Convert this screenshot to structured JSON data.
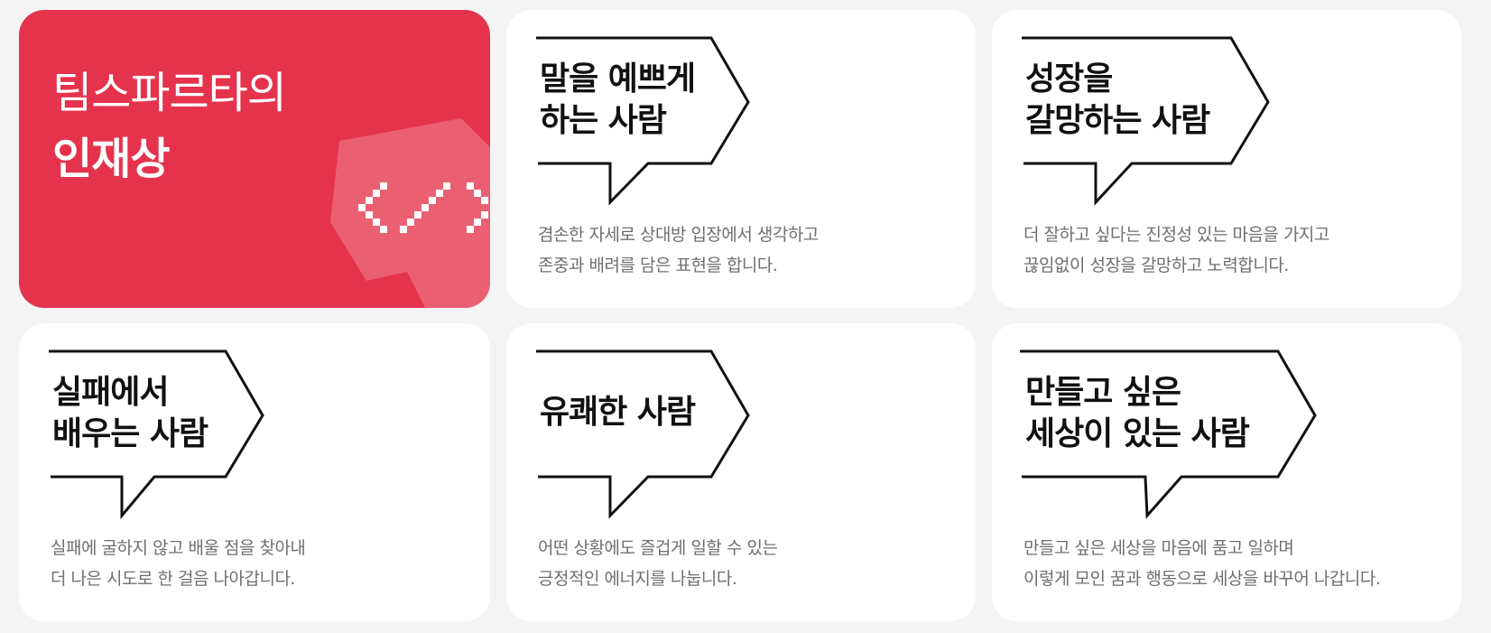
{
  "hero": {
    "line1": "팀스파르타의",
    "line2": "인재상",
    "icon": "code-bubble-icon",
    "colors": {
      "background": "#e5334d",
      "bubble": "#ea6072"
    }
  },
  "cards": [
    {
      "title": [
        "말을 예쁘게",
        "하는 사람"
      ],
      "desc": [
        "겸손한 자세로 상대방 입장에서 생각하고",
        "존중과 배려를 담은 표현을 합니다."
      ]
    },
    {
      "title": [
        "성장을",
        "갈망하는 사람"
      ],
      "desc": [
        "더 잘하고 싶다는 진정성 있는 마음을 가지고",
        "끊임없이 성장을 갈망하고 노력합니다."
      ]
    },
    {
      "title": [
        "실패에서",
        "배우는 사람"
      ],
      "desc": [
        "실패에 굴하지 않고 배울 점을 찾아내",
        "더 나은 시도로 한 걸음 나아갑니다."
      ]
    },
    {
      "title": [
        "유쾌한 사람"
      ],
      "desc": [
        "어떤 상황에도 즐겁게 일할 수 있는",
        "긍정적인 에너지를 나눕니다."
      ]
    },
    {
      "title": [
        "만들고 싶은",
        "세상이 있는 사람"
      ],
      "desc": [
        "만들고 싶은 세상을 마음에 품고 일하며",
        "이렇게 모인 꿈과 행동으로 세상을 바꾸어 나갑니다."
      ]
    }
  ]
}
